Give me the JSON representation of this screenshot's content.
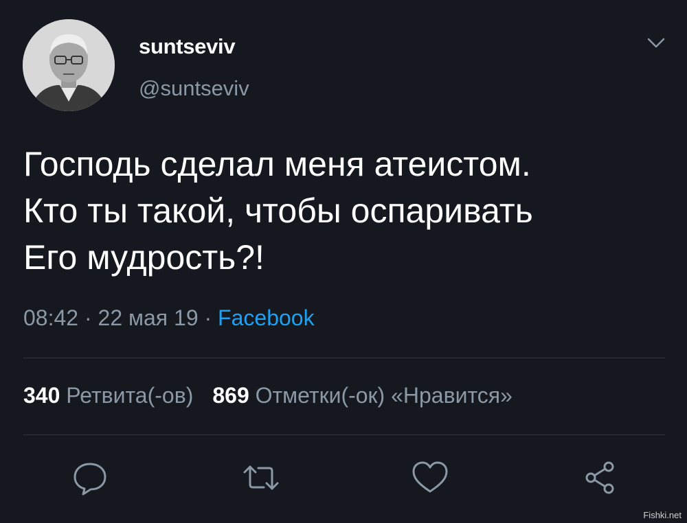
{
  "user": {
    "display_name": "suntseviv",
    "handle": "@suntseviv"
  },
  "tweet": {
    "lines": [
      "Господь сделал меня атеистом.",
      "Кто ты такой, чтобы оспаривать",
      "Его мудрость?!"
    ],
    "time": "08:42",
    "date": "22 мая 19",
    "separator": "·",
    "source": "Facebook"
  },
  "stats": {
    "retweets_count": "340",
    "retweets_label": "Ретвита(-ов)",
    "likes_count": "869",
    "likes_label": "Отметки(-ок) «Нравится»"
  },
  "actions": [
    {
      "icon": "reply-icon"
    },
    {
      "icon": "retweet-icon"
    },
    {
      "icon": "like-icon"
    },
    {
      "icon": "share-icon"
    }
  ],
  "colors": {
    "background": "#15181f",
    "text": "#ffffff",
    "secondary": "#8b98a5",
    "link": "#1da1f2",
    "divider": "#2f3640"
  },
  "watermark": "Fishki.net"
}
